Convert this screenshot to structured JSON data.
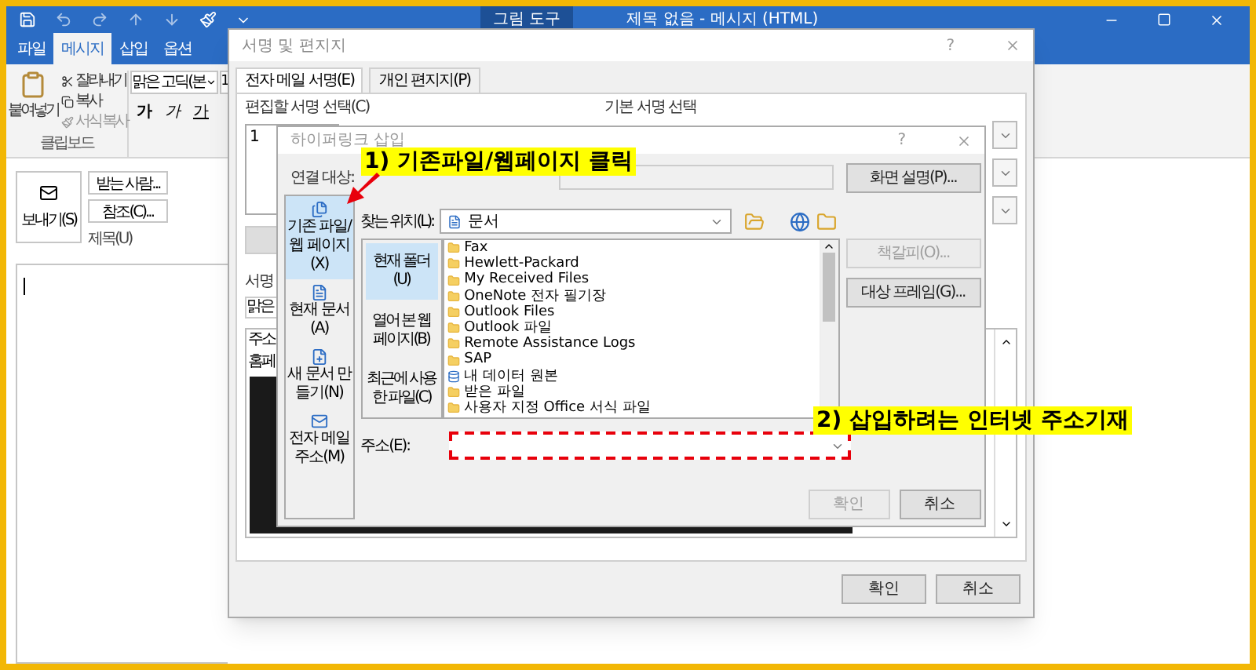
{
  "window": {
    "title": "제목 없음 - 메시지 (HTML)",
    "context_tab": "그림 도구"
  },
  "ribbon_tabs": [
    {
      "label": "파일",
      "selected": false
    },
    {
      "label": "메시지",
      "selected": true
    },
    {
      "label": "삽입",
      "selected": false
    },
    {
      "label": "옵션",
      "selected": false
    }
  ],
  "clipboard": {
    "paste": "붙여넣기",
    "items": [
      "잘라내기",
      "복사",
      "서식 복사"
    ],
    "group": "클립보드"
  },
  "font": {
    "name": "맑은 고딕(본",
    "size": "1",
    "styles": [
      "가",
      "가",
      "가"
    ]
  },
  "compose": {
    "send": "보내기(S)",
    "to": "받는 사람...",
    "cc": "참조(C)...",
    "subject": "제목(U)"
  },
  "signature_dialog": {
    "title": "서명 및 편지지",
    "help": "?",
    "tabs": [
      {
        "label": "전자 메일 서명(E)",
        "selected": true
      },
      {
        "label": "개인 편지지(P)",
        "selected": false
      }
    ],
    "edit_label": "편집할 서명 선택(C)",
    "default_label": "기본 서명 선택",
    "list": [
      "1"
    ],
    "section_label": "서명",
    "font_value": "맑은",
    "body_lines": [
      "주소",
      "홈페"
    ],
    "buttons": [
      "확인",
      "취소"
    ]
  },
  "hyperlink_dialog": {
    "title": "하이퍼링크 삽입",
    "help": "?",
    "link_to_label": "연결 대상:",
    "link_to": [
      {
        "label": "기존 파일/웹 페이지(X)",
        "selected": true,
        "kind": "file"
      },
      {
        "label": "현재 문서(A)",
        "selected": false,
        "kind": "document"
      },
      {
        "label": "새 문서 만들기(N)",
        "selected": false,
        "kind": "new"
      },
      {
        "label": "전자 메일 주소(M)",
        "selected": false,
        "kind": "email"
      }
    ],
    "look_in_label": "찾는 위치(L):",
    "look_in": "문서",
    "places": [
      {
        "label": "현재 폴더(U)",
        "selected": true
      },
      {
        "label": "열어 본 웹 페이지(B)",
        "selected": false
      },
      {
        "label": "최근에 사용한 파일(C)",
        "selected": false
      }
    ],
    "files": [
      {
        "name": "Fax",
        "kind": "folder"
      },
      {
        "name": "Hewlett-Packard",
        "kind": "folder"
      },
      {
        "name": "My Received Files",
        "kind": "folder"
      },
      {
        "name": "OneNote 전자 필기장",
        "kind": "folder"
      },
      {
        "name": "Outlook Files",
        "kind": "folder"
      },
      {
        "name": "Outlook 파일",
        "kind": "folder"
      },
      {
        "name": "Remote Assistance Logs",
        "kind": "folder"
      },
      {
        "name": "SAP",
        "kind": "folder"
      },
      {
        "name": "내 데이터 원본",
        "kind": "datasource"
      },
      {
        "name": "받은 파일",
        "kind": "folder"
      },
      {
        "name": "사용자 지정 Office 서식 파일",
        "kind": "folder"
      }
    ],
    "side_buttons": [
      {
        "label": "화면 설명(P)...",
        "disabled": false
      },
      {
        "label": "책갈피(O)...",
        "disabled": true
      },
      {
        "label": "대상 프레임(G)...",
        "disabled": false
      }
    ],
    "address_label": "주소(E):",
    "buttons": [
      {
        "label": "확인",
        "disabled": true
      },
      {
        "label": "취소",
        "disabled": false
      }
    ]
  },
  "annotations": [
    "1) 기존파일/웹페이지 클릭",
    "2) 삽입하려는 인터넷 주소기재"
  ]
}
